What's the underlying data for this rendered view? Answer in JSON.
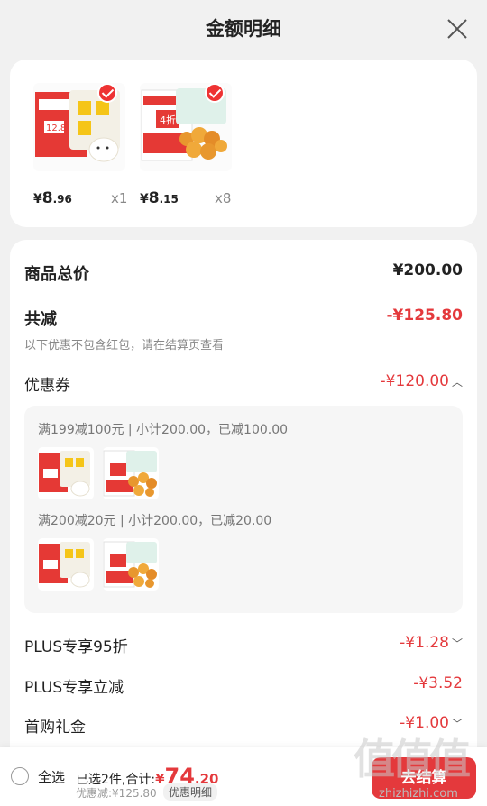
{
  "header": {
    "title": "金额明细",
    "close_icon": "close-icon"
  },
  "products": [
    {
      "currency": "¥",
      "price_int": "8",
      "price_dec": ".96",
      "qty": "x1",
      "thumb_icon": "bun-product-image",
      "checked": true
    },
    {
      "currency": "¥",
      "price_int": "8",
      "price_dec": ".15",
      "qty": "x8",
      "thumb_icon": "popcorn-chicken-product-image",
      "checked": true
    }
  ],
  "summary": {
    "total_label": "商品总价",
    "total_value": "¥200.00",
    "discount_label": "共减",
    "discount_value": "-¥125.80",
    "discount_note": "以下优惠不包含红包，请在结算页查看",
    "coupon_label": "优惠券",
    "coupon_value": "-¥120.00"
  },
  "coupons": [
    {
      "title": "满199减100元 | 小计200.00，已减100.00"
    },
    {
      "title": "满200减20元 | 小计200.00，已减20.00"
    }
  ],
  "extras": [
    {
      "label": "PLUS专享95折",
      "value": "-¥1.28",
      "expandable": true
    },
    {
      "label": "PLUS专享立减",
      "value": "-¥3.52",
      "expandable": false
    },
    {
      "label": "首购礼金",
      "value": "-¥1.00",
      "expandable": true
    }
  ],
  "bottom": {
    "select_all": "全选",
    "selected_prefix": "已选2件,合计:",
    "currency": "¥",
    "total_int": "74",
    "total_dec": ".20",
    "saved": "优惠减:¥125.80",
    "detail_button": "优惠明细",
    "settle_button": "去结算"
  },
  "watermark": {
    "text": "值值值",
    "site": "zhizhizhi.com"
  },
  "colors": {
    "accent": "#e4393c",
    "background": "#f1f1f1"
  }
}
